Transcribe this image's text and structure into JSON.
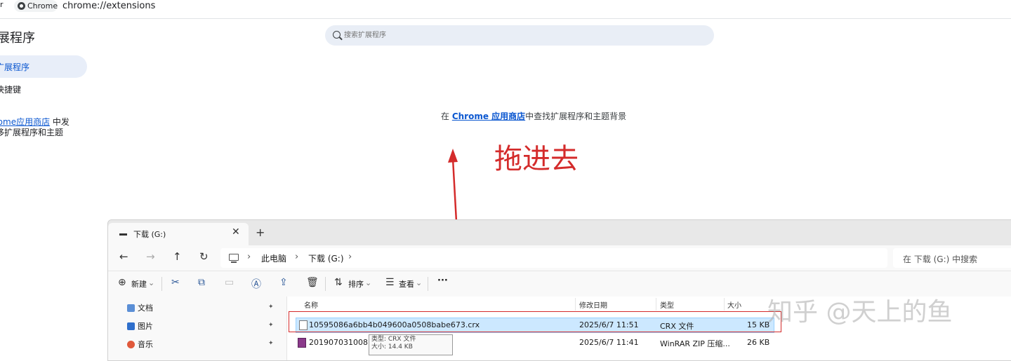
{
  "browser": {
    "tab_label": "Chrome",
    "url": "chrome://extensions",
    "edge_glyph": "r"
  },
  "sidebar": {
    "title": "展程序",
    "items": [
      {
        "label": "广展程序"
      },
      {
        "label": "快捷键"
      }
    ],
    "store_prefix": "rome",
    "store_link": "应用商店",
    "store_suffix": " 中发",
    "store_line2": "哆扩展程序和主题"
  },
  "search": {
    "placeholder": "搜索扩展程序"
  },
  "empty_state": {
    "prefix": "在 ",
    "link": "Chrome 应用商店",
    "suffix": "中查找扩展程序和主题背景"
  },
  "annotation": {
    "text": "拖进去",
    "color": "#d42b2b"
  },
  "explorer": {
    "tab_label": "下载 (G:)",
    "close_glyph": "✕",
    "new_tab_glyph": "+",
    "nav": {
      "back": "←",
      "forward": "→",
      "up": "↑",
      "refresh": "↻"
    },
    "breadcrumbs": [
      "此电脑",
      "下载 (G:)"
    ],
    "crumb_sep": "›",
    "search_placeholder": "在 下载 (G:) 中搜索",
    "toolbar": {
      "new_label": "新建",
      "sort_label": "排序",
      "view_label": "查看",
      "more_glyph": "···",
      "chevron": "⌄"
    },
    "nav_pane": [
      {
        "label": "文档",
        "icon": "document-icon",
        "color": "#5b8fd6"
      },
      {
        "label": "图片",
        "icon": "pictures-icon",
        "color": "#2f6fcc"
      },
      {
        "label": "音乐",
        "icon": "music-icon",
        "color": "#e0593b"
      }
    ],
    "pin_glyph": "📌",
    "columns": [
      "名称",
      "修改日期",
      "类型",
      "大小"
    ],
    "files": [
      {
        "name": "10595086a6bb4b049600a0508babe673.crx",
        "date": "2025/6/7 11:51",
        "type": "CRX 文件",
        "size": "15 KB",
        "icon": "crx-file-icon",
        "selected": true
      },
      {
        "name": "20190703100816",
        "date": "2025/6/7 11:41",
        "type": "WinRAR ZIP 压缩...",
        "size": "26 KB",
        "icon": "winrar-icon",
        "selected": false
      }
    ],
    "tooltip": {
      "line1": "类型: CRX 文件",
      "line2": "大小: 14.4 KB"
    }
  },
  "watermark": "知乎 @天上的鱼"
}
